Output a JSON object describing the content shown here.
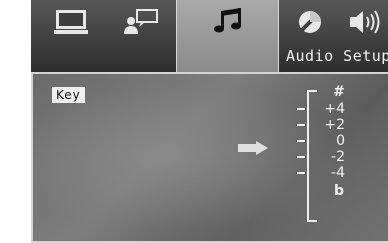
{
  "menu": {
    "tabs": [
      {
        "id": "general",
        "icon": "monitor-icon"
      },
      {
        "id": "language",
        "icon": "person-speech-icon"
      },
      {
        "id": "audio",
        "icon": "music-note-icon",
        "active": true
      },
      {
        "id": "video",
        "icon": "color-disc-icon"
      },
      {
        "id": "speaker",
        "icon": "speaker-icon"
      }
    ],
    "active_label": "Audio Setup"
  },
  "content": {
    "key_label": "Key",
    "scale": {
      "sharp_symbol": "#",
      "flat_symbol": "b",
      "levels": [
        "+4",
        "+2",
        "0",
        "-2",
        "-4"
      ],
      "current_value": "0"
    }
  },
  "colors": {
    "menu_bar": "#3e3e3e",
    "active_tab": "#9a9a9a",
    "text": "#f2f2f2"
  }
}
